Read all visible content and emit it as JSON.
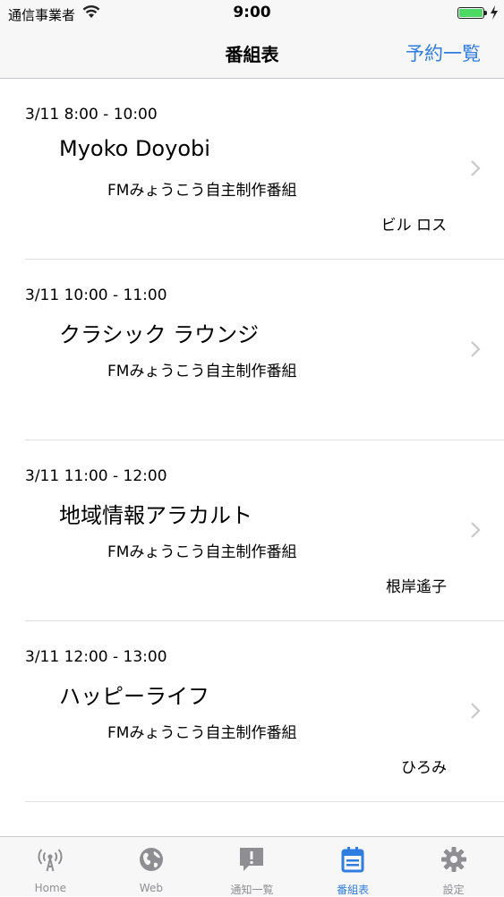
{
  "status_bar": {
    "carrier": "通信事業者",
    "time": "9:00"
  },
  "nav": {
    "title": "番組表",
    "right_button": "予約一覧"
  },
  "programs": [
    {
      "time": "3/11 8:00 - 10:00",
      "title": "Myoko Doyobi",
      "station": "FMみょうこう自主制作番組",
      "host": "ビル ロス"
    },
    {
      "time": "3/11 10:00 - 11:00",
      "title": "クラシック ラウンジ",
      "station": "FMみょうこう自主制作番組",
      "host": ""
    },
    {
      "time": "3/11 11:00 - 12:00",
      "title": "地域情報アラカルト",
      "station": "FMみょうこう自主制作番組",
      "host": "根岸遙子"
    },
    {
      "time": "3/11 12:00 - 13:00",
      "title": "ハッピーライフ",
      "station": "FMみょうこう自主制作番組",
      "host": "ひろみ"
    }
  ],
  "tabs": [
    {
      "label": "Home",
      "icon": "broadcast-icon"
    },
    {
      "label": "Web",
      "icon": "globe-icon"
    },
    {
      "label": "通知一覧",
      "icon": "notification-icon"
    },
    {
      "label": "番組表",
      "icon": "calendar-icon",
      "active": true
    },
    {
      "label": "設定",
      "icon": "gear-icon"
    }
  ],
  "colors": {
    "accent": "#2f7de1",
    "inactive": "#8e8e93",
    "battery": "#4cd964"
  }
}
